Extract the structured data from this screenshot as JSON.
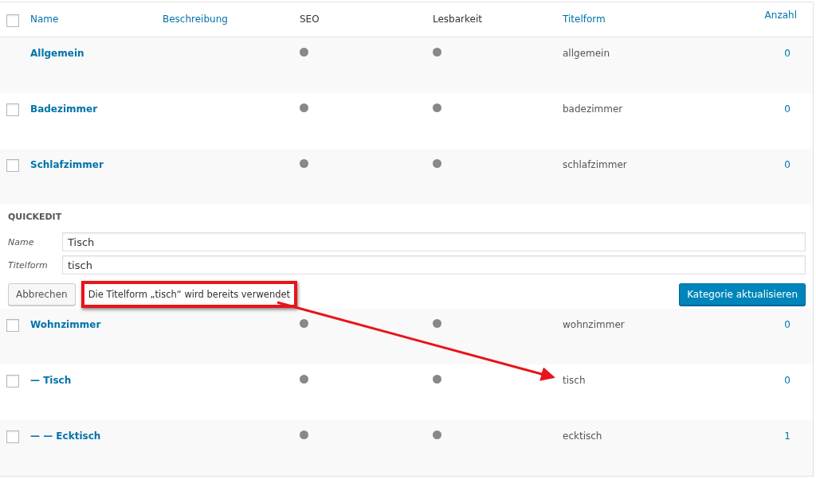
{
  "select_all": {
    "checked": false
  },
  "columns": [
    {
      "label": "Name",
      "sortable": true
    },
    {
      "label": "Beschreibung",
      "sortable": true
    },
    {
      "label": "SEO",
      "sortable": false
    },
    {
      "label": "Lesbarkeit",
      "sortable": false
    },
    {
      "label": "Titelform",
      "sortable": true
    },
    {
      "label": "Anzahl",
      "sortable": true
    }
  ],
  "rows_before": [
    {
      "name": "Allgemein",
      "slug": "allgemein",
      "count": "0",
      "checkbox": false
    },
    {
      "name": "Badezimmer",
      "slug": "badezimmer",
      "count": "0",
      "checkbox": true,
      "checked": false
    },
    {
      "name": "Schlafzimmer",
      "slug": "schlafzimmer",
      "count": "0",
      "checkbox": true,
      "checked": false
    }
  ],
  "quickedit": {
    "title": "QUICKEDIT",
    "fields": [
      {
        "label": "Name",
        "value": "Tisch"
      },
      {
        "label": "Titelform",
        "value": "tisch"
      }
    ],
    "cancel": "Abbrechen",
    "error": "Die Titelform „tisch“ wird bereits verwendet",
    "submit": "Kategorie aktualisieren"
  },
  "rows_after": [
    {
      "name": "Wohnzimmer",
      "slug": "wohnzimmer",
      "count": "0",
      "checkbox": true,
      "checked": false
    },
    {
      "name": "— Tisch",
      "slug": "tisch",
      "count": "0",
      "checkbox": true,
      "checked": false
    },
    {
      "name": "— — Ecktisch",
      "slug": "ecktisch",
      "count": "1",
      "checkbox": true,
      "checked": false
    }
  ]
}
